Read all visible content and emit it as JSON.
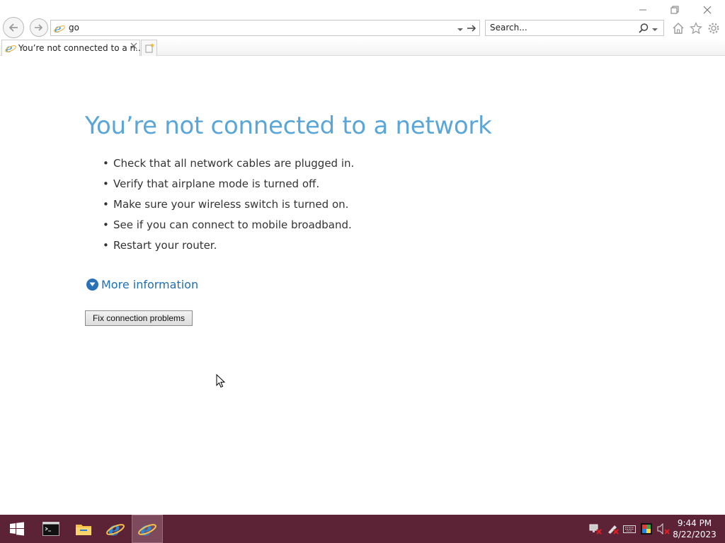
{
  "browser": {
    "address": {
      "value": "go"
    },
    "search": {
      "placeholder": "Search..."
    },
    "tab": {
      "title": "You’re not connected to a n..."
    }
  },
  "page": {
    "heading": "You’re not connected to a network",
    "tips": [
      "Check that all network cables are plugged in.",
      "Verify that airplane mode is turned off.",
      "Make sure your wireless switch is turned on.",
      "See if you can connect to mobile broadband.",
      "Restart your router."
    ],
    "more_info_label": "More information",
    "fix_button_label": "Fix connection problems"
  },
  "taskbar": {
    "time": "9:44 PM",
    "date": "8/22/2023"
  },
  "colors": {
    "heading": "#5aa6d8",
    "link": "#1f6fb4",
    "taskbar": "#5c2236"
  },
  "icons": [
    "minimize-icon",
    "restore-icon",
    "close-icon",
    "back-arrow-icon",
    "forward-arrow-icon",
    "ie-page-icon",
    "dropdown-icon",
    "go-arrow-icon",
    "search-icon",
    "home-icon",
    "favorites-star-icon",
    "tools-gear-icon",
    "new-tab-icon",
    "chevron-down-icon",
    "mouse-cursor-icon",
    "windows-start-icon",
    "command-prompt-icon",
    "file-explorer-icon",
    "internet-explorer-icon",
    "network-icon",
    "action-center-icon",
    "keyboard-icon",
    "color-icon",
    "volume-muted-icon"
  ]
}
